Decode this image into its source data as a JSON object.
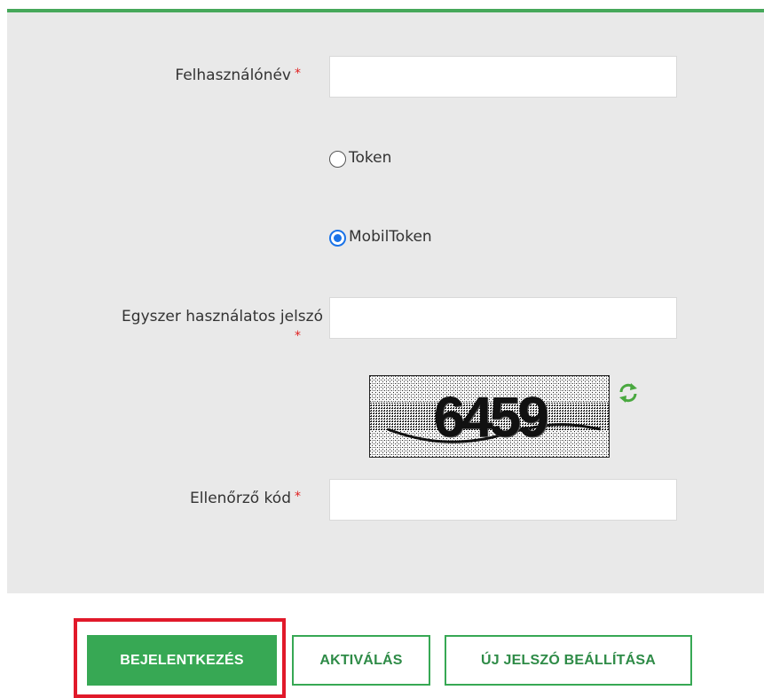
{
  "form": {
    "username_label": "Felhasználónév",
    "username_value": "",
    "required_mark": "*",
    "auth_options": [
      {
        "label": "Token",
        "selected": false
      },
      {
        "label": "MobilToken",
        "selected": true
      }
    ],
    "otp_label": "Egyszer használatos jelszó",
    "otp_value": "",
    "captcha_text": "6459",
    "captcha_refresh_icon": "refresh-icon",
    "verify_label": "Ellenőrző kód",
    "verify_value": ""
  },
  "actions": {
    "login": "BEJELENTKEZÉS",
    "activate": "AKTIVÁLÁS",
    "new_password": "ÚJ JELSZÓ BEÁLLÍTÁSA"
  },
  "colors": {
    "accent_green": "#37a854",
    "panel_bg": "#e9e9e9",
    "required_red": "#e02020",
    "highlight_red": "#e1192a",
    "radio_blue": "#1a73e8"
  }
}
